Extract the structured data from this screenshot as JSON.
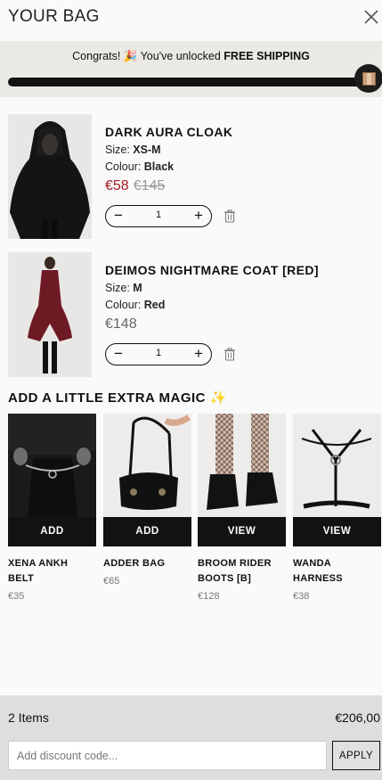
{
  "header": {
    "title": "YOUR BAG",
    "close_icon": "close-icon"
  },
  "shipping": {
    "message_prefix": "Congrats! 🎉 You've unlocked",
    "message_bold": "FREE SHIPPING",
    "progress": 1.0
  },
  "cart": {
    "items": [
      {
        "name": "DARK AURA CLOAK",
        "size_label": "Size:",
        "size": "XS-M",
        "colour_label": "Colour:",
        "colour": "Black",
        "price": "€58",
        "old_price": "€145",
        "quantity": "1"
      },
      {
        "name": "DEIMOS NIGHTMARE COAT [RED]",
        "size_label": "Size:",
        "size": "M",
        "colour_label": "Colour:",
        "colour": "Red",
        "price": "€148",
        "quantity": "1"
      }
    ]
  },
  "extra": {
    "title": "ADD A LITTLE EXTRA MAGIC ✨",
    "products": [
      {
        "name": "XENA ANKH BELT",
        "price": "€35",
        "button": "ADD"
      },
      {
        "name": "ADDER BAG",
        "price": "€65",
        "button": "ADD"
      },
      {
        "name": "BROOM RIDER BOOTS [B]",
        "price": "€128",
        "button": "VIEW"
      },
      {
        "name": "WANDA HARNESS",
        "price": "€38",
        "button": "VIEW"
      }
    ]
  },
  "footer": {
    "items_count": "2 Items",
    "total": "€206,00",
    "discount_placeholder": "Add discount code...",
    "apply_label": "APPLY"
  },
  "colors": {
    "sale": "#a31a1f",
    "dark": "#121212",
    "banner": "#ebe9e4",
    "footer": "#dedede"
  }
}
